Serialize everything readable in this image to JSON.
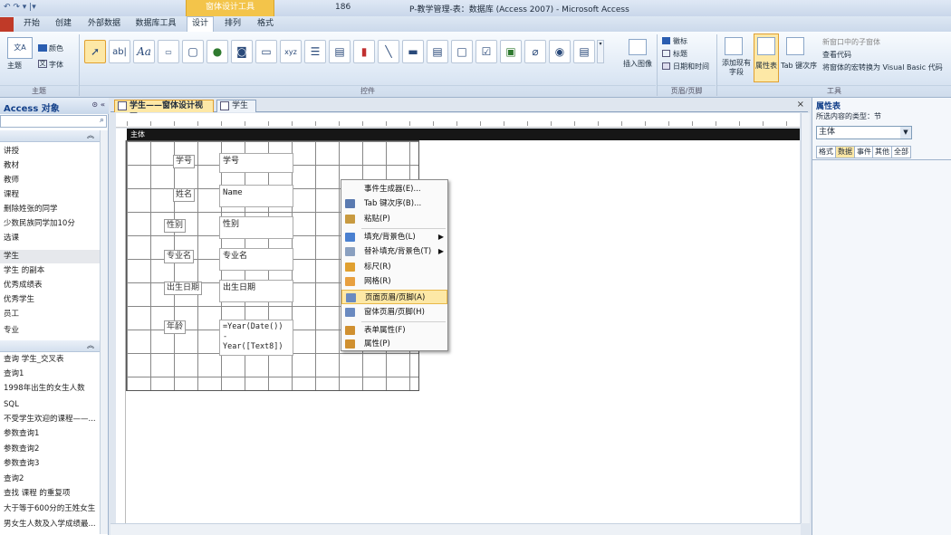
{
  "window": {
    "title": "P-教学管理-表：数据库 (Access 2007) - Microsoft Access",
    "title_prefix": "186",
    "context_tab_header": "窗体设计工具"
  },
  "ribbon_tabs": [
    {
      "label": "开始"
    },
    {
      "label": "创建"
    },
    {
      "label": "外部数据"
    },
    {
      "label": "数据库工具"
    },
    {
      "label": "设计"
    },
    {
      "label": "排列"
    },
    {
      "label": "格式"
    }
  ],
  "ribbon": {
    "theme_group": {
      "label": "主题",
      "themes": "主题",
      "colors": "颜色",
      "fonts": "字体"
    },
    "controls_group": {
      "label": "控件",
      "textbox_glyph": "ab|",
      "label_glyph": "Aa",
      "insert_image": "插入图像"
    },
    "header_footer_group": {
      "label": "页眉/页脚",
      "logo": "徽标",
      "title": "标题",
      "datetime": "日期和时间"
    },
    "tools_group": {
      "label": "工具",
      "add_fields": "添加现有字段",
      "property_sheet": "属性表",
      "tab_order": "Tab 键次序",
      "new_subform": "新窗口中的子窗体",
      "view_code": "查看代码",
      "convert_macros": "将窗体的宏转换为 Visual Basic 代码"
    }
  },
  "nav": {
    "title": "Access 对象",
    "tables": [
      "讲授",
      "教材",
      "教师",
      "课程",
      "删除姓张的同学",
      "少数民族同学加10分",
      "选课",
      "学生",
      "学生 的副本",
      "优秀成绩表",
      "优秀学生",
      "员工",
      "专业"
    ],
    "selected": "学生",
    "queries": [
      "查询 学生_交叉表",
      "查询1",
      "1998年出生的女生人数",
      "SQL",
      "不受学生欢迎的课程——...",
      "参数查询1",
      "参数查询2",
      "参数查询3",
      "查询2",
      "查找 课程 的重复项",
      "大于等于600分的王姓女生",
      "男女生人数及入学成绩最..."
    ]
  },
  "doc_tabs": [
    {
      "label": "学生——窗体设计视图",
      "active": true
    },
    {
      "label": "学生",
      "active": false
    }
  ],
  "form": {
    "section": "主体",
    "fields": [
      {
        "label": "学号",
        "control": "学号"
      },
      {
        "label": "姓名",
        "control": "Name"
      },
      {
        "label": "性别",
        "control": "性别"
      },
      {
        "label": "专业名",
        "control": "专业名"
      },
      {
        "label": "出生日期",
        "control": "出生日期"
      },
      {
        "label": "年龄",
        "control": "=Year(Date())\n-\nYear([Text8])"
      }
    ]
  },
  "context_menu": [
    {
      "label": "事件生成器(E)...",
      "icon": "event-builder-icon",
      "submenu": false
    },
    {
      "label": "Tab 键次序(B)...",
      "icon": "tab-order-icon",
      "submenu": false
    },
    {
      "label": "粘贴(P)",
      "icon": "paste-icon",
      "submenu": false
    },
    {
      "label": "填充/背景色(L)",
      "icon": "fill-color-icon",
      "submenu": true
    },
    {
      "label": "替补填充/背景色(T)",
      "icon": "alt-fill-color-icon",
      "submenu": true
    },
    {
      "label": "标尺(R)",
      "icon": "ruler-icon",
      "submenu": false
    },
    {
      "label": "网格(R)",
      "icon": "grid-icon",
      "submenu": false
    },
    {
      "label": "页面页眉/页脚(A)",
      "icon": "page-header-footer-icon",
      "submenu": false,
      "highlighted": true
    },
    {
      "label": "窗体页眉/页脚(H)",
      "icon": "form-header-footer-icon",
      "submenu": false
    },
    {
      "label": "表单属性(F)",
      "icon": "form-properties-icon",
      "submenu": false
    },
    {
      "label": "属性(P)",
      "icon": "properties-icon",
      "submenu": false
    }
  ],
  "property_sheet": {
    "title": "属性表",
    "selection_type_label": "所选内容的类型：节",
    "selected_object": "主体",
    "tabs": [
      "格式",
      "数据",
      "事件",
      "其他",
      "全部"
    ]
  },
  "colors": {
    "context_tab": "#f3c44a",
    "file_tab": "#c03a28",
    "menu_highlight": "#fde8a6"
  }
}
